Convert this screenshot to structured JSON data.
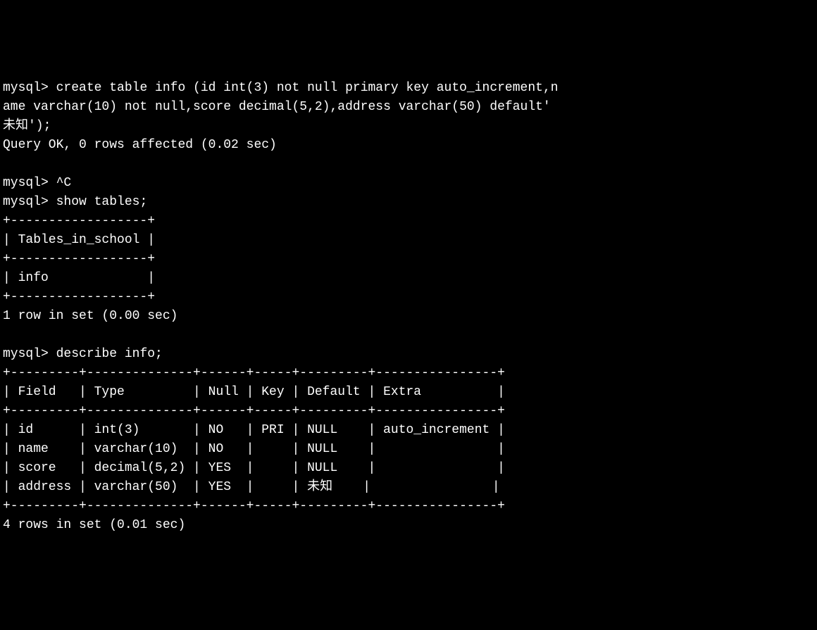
{
  "prompt": "mysql>",
  "commands": {
    "create_table": "create table info (id int(3) not null primary key auto_increment,n",
    "create_table_line2": "ame varchar(10) not null,score decimal(5,2),address varchar(50) default'",
    "create_table_line3": "未知');",
    "create_result": "Query OK, 0 rows affected (0.02 sec)",
    "interrupt": "^C",
    "show_tables": "show tables;",
    "describe": "describe info;"
  },
  "tables_result": {
    "border_top": "+------------------+",
    "header": "| Tables_in_school |",
    "border_mid": "+------------------+",
    "row1": "| info             |",
    "border_bottom": "+------------------+",
    "summary": "1 row in set (0.00 sec)"
  },
  "describe_result": {
    "border_top": "+---------+--------------+------+-----+---------+----------------+",
    "header": "| Field   | Type         | Null | Key | Default | Extra          |",
    "border_mid": "+---------+--------------+------+-----+---------+----------------+",
    "row1": "| id      | int(3)       | NO   | PRI | NULL    | auto_increment |",
    "row2": "| name    | varchar(10)  | NO   |     | NULL    |                |",
    "row3": "| score   | decimal(5,2) | YES  |     | NULL    |                |",
    "row4": "| address | varchar(50)  | YES  |     | 未知    |                |",
    "border_bottom": "+---------+--------------+------+-----+---------+----------------+",
    "summary": "4 rows in set (0.01 sec)"
  },
  "chart_data": {
    "type": "table",
    "tables": [
      {
        "title": "Tables_in_school",
        "columns": [
          "Tables_in_school"
        ],
        "rows": [
          [
            "info"
          ]
        ]
      },
      {
        "title": "describe info",
        "columns": [
          "Field",
          "Type",
          "Null",
          "Key",
          "Default",
          "Extra"
        ],
        "rows": [
          [
            "id",
            "int(3)",
            "NO",
            "PRI",
            "NULL",
            "auto_increment"
          ],
          [
            "name",
            "varchar(10)",
            "NO",
            "",
            "NULL",
            ""
          ],
          [
            "score",
            "decimal(5,2)",
            "YES",
            "",
            "NULL",
            ""
          ],
          [
            "address",
            "varchar(50)",
            "YES",
            "",
            "未知",
            ""
          ]
        ]
      }
    ]
  }
}
